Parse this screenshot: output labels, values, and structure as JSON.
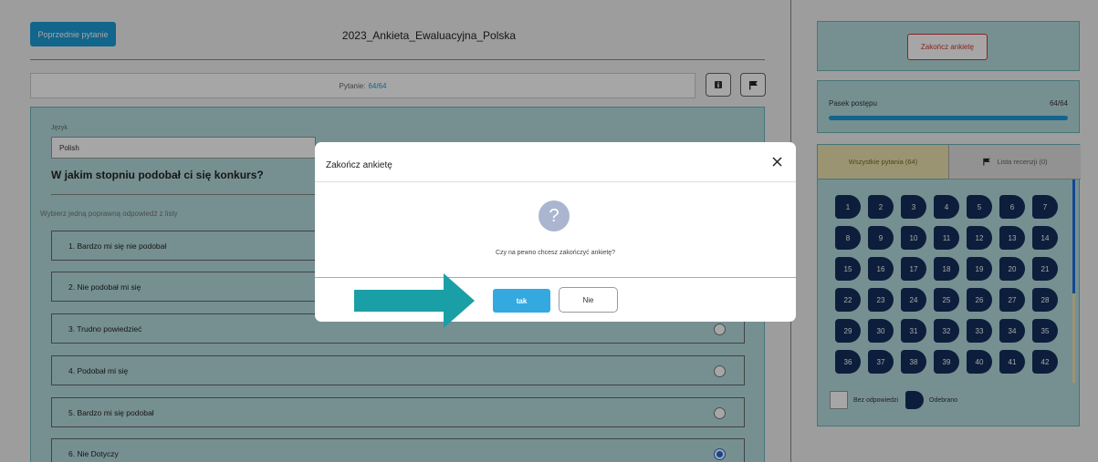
{
  "header": {
    "prev_button": "Poprzednie pytanie",
    "survey_title": "2023_Ankieta_Ewaluacyjna_Polska"
  },
  "counter": {
    "label": "Pytanie:",
    "value": "64/64"
  },
  "question": {
    "language_label": "Język",
    "language_value": "Polish",
    "text": "W jakim stopniu podobał ci się konkurs?",
    "hint": "Wybierz jedną poprawną odpowiedź z listy",
    "options": [
      "1.  Bardzo mi się nie podobał",
      "2.  Nie podobał mi się",
      "3.  Trudno powiedzieć",
      "4.  Podobał mi się",
      "5.  Bardzo mi się podobał",
      "6.  Nie Dotyczy"
    ],
    "selected_index": 5
  },
  "sidebar": {
    "end_button": "Zakończ ankietę",
    "progress_label": "Pasek postępu",
    "progress_count": "64/64",
    "progress_fraction": 1.0,
    "tab_all": "Wszystkie pytania (64)",
    "tab_review": "Lista recenzji (0)",
    "question_numbers": [
      "1",
      "2",
      "3",
      "4",
      "5",
      "6",
      "7",
      "8",
      "9",
      "10",
      "11",
      "12",
      "13",
      "14",
      "15",
      "16",
      "17",
      "18",
      "19",
      "20",
      "21",
      "22",
      "23",
      "24",
      "25",
      "26",
      "27",
      "28",
      "29",
      "30",
      "31",
      "32",
      "33",
      "34",
      "35",
      "36",
      "37",
      "38",
      "39",
      "40",
      "41",
      "42"
    ],
    "legend_empty": "Bez odpowiedzi",
    "legend_answered": "Odebrano"
  },
  "modal": {
    "title": "Zakończ ankietę",
    "message": "Czy na pewno chcesz zakończyć ankietę?",
    "icon_glyph": "?",
    "confirm": "tak",
    "cancel": "Nie"
  },
  "colors": {
    "accent": "#1d9bd6",
    "panel": "#b6dde0",
    "navy": "#142f5c",
    "danger": "#d03a3a",
    "arrow": "#1a9fa6"
  }
}
